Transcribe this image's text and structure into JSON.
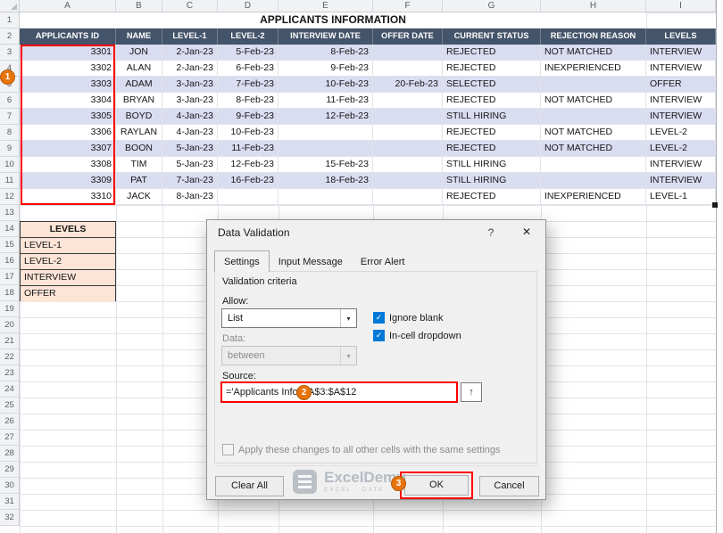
{
  "colors": {
    "table-header-bg": "#44546A",
    "band-row-bg": "#DADDF2",
    "levels-bg": "#FCE4D6",
    "annotation-red": "#FF0000",
    "annotation-orange": "#E8740C",
    "checkbox-blue": "#0078D7",
    "grid-line": "#E2E3E8"
  },
  "icons": {
    "help": "?",
    "close": "✕",
    "dropdown": "▾",
    "check": "✓",
    "range_select": "↑"
  },
  "sheet": {
    "column_headers": [
      "A",
      "B",
      "C",
      "D",
      "E",
      "F",
      "G",
      "H",
      "I"
    ],
    "row_count": 32,
    "title": "APPLICANTS INFORMATION",
    "table": {
      "headers": [
        "APPLICANTS ID",
        "NAME",
        "LEVEL-1",
        "LEVEL-2",
        "INTERVIEW DATE",
        "OFFER DATE",
        "CURRENT STATUS",
        "REJECTION REASON",
        "LEVELS"
      ],
      "rows": [
        [
          "3301",
          "JON",
          "2-Jan-23",
          "5-Feb-23",
          "8-Feb-23",
          "",
          "REJECTED",
          "NOT MATCHED",
          "INTERVIEW"
        ],
        [
          "3302",
          "ALAN",
          "2-Jan-23",
          "6-Feb-23",
          "9-Feb-23",
          "",
          "REJECTED",
          "INEXPERIENCED",
          "INTERVIEW"
        ],
        [
          "3303",
          "ADAM",
          "3-Jan-23",
          "7-Feb-23",
          "10-Feb-23",
          "20-Feb-23",
          "SELECTED",
          "",
          "OFFER"
        ],
        [
          "3304",
          "BRYAN",
          "3-Jan-23",
          "8-Feb-23",
          "11-Feb-23",
          "",
          "REJECTED",
          "NOT MATCHED",
          "INTERVIEW"
        ],
        [
          "3305",
          "BOYD",
          "4-Jan-23",
          "9-Feb-23",
          "12-Feb-23",
          "",
          "STILL HIRING",
          "",
          "INTERVIEW"
        ],
        [
          "3306",
          "RAYLAN",
          "4-Jan-23",
          "10-Feb-23",
          "",
          "",
          "REJECTED",
          "NOT MATCHED",
          "LEVEL-2"
        ],
        [
          "3307",
          "BOON",
          "5-Jan-23",
          "11-Feb-23",
          "",
          "",
          "REJECTED",
          "NOT MATCHED",
          "LEVEL-2"
        ],
        [
          "3308",
          "TIM",
          "5-Jan-23",
          "12-Feb-23",
          "15-Feb-23",
          "",
          "STILL HIRING",
          "",
          "INTERVIEW"
        ],
        [
          "3309",
          "PAT",
          "7-Jan-23",
          "16-Feb-23",
          "18-Feb-23",
          "",
          "STILL HIRING",
          "",
          "INTERVIEW"
        ],
        [
          "3310",
          "JACK",
          "8-Jan-23",
          "",
          "",
          "",
          "REJECTED",
          "INEXPERIENCED",
          "LEVEL-1"
        ]
      ]
    },
    "levels_list": {
      "header": "LEVELS",
      "items": [
        "LEVEL-1",
        "LEVEL-2",
        "INTERVIEW",
        "OFFER"
      ]
    }
  },
  "dialog": {
    "title": "Data Validation",
    "tabs": [
      "Settings",
      "Input Message",
      "Error Alert"
    ],
    "active_tab": "Settings",
    "validation_criteria_label": "Validation criteria",
    "allow_label": "Allow:",
    "allow_value": "List",
    "ignore_blank_label": "Ignore blank",
    "in_cell_dropdown_label": "In-cell dropdown",
    "data_label": "Data:",
    "data_value": "between",
    "source_label": "Source:",
    "source_value": "='Applicants Info'!$A$3:$A$12",
    "apply_label": "Apply these changes to all other cells with the same settings",
    "clear_all_label": "Clear All",
    "ok_label": "OK",
    "cancel_label": "Cancel"
  },
  "annotations": {
    "step1": "1",
    "step2": "2",
    "step3": "3"
  },
  "watermark": {
    "brand": "ExcelDemy",
    "tagline": "EXCEL · DATA · BI"
  }
}
